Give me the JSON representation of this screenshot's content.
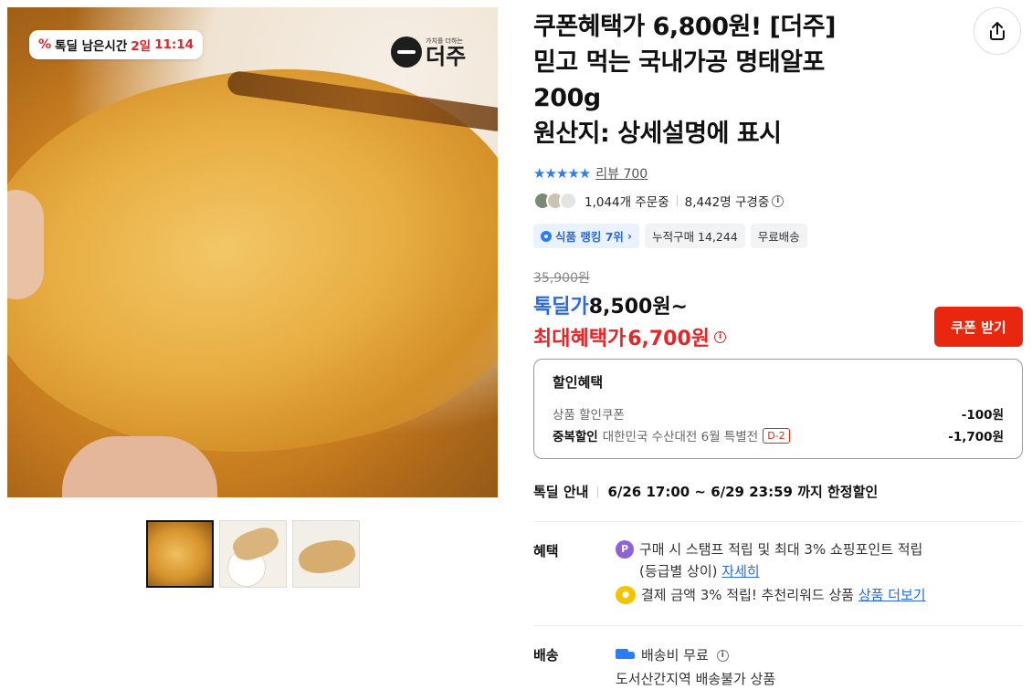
{
  "image": {
    "deal_timer": {
      "prefix": "톡딜 남은시간",
      "days": "2일",
      "time": "11:14"
    },
    "brand": {
      "sub": "가치를 더하는",
      "name": "더주"
    },
    "thumbnails": [
      "thumbnail-1",
      "thumbnail-2",
      "thumbnail-3"
    ]
  },
  "product": {
    "title_lines": [
      "쿠폰혜택가 6,800원! [더주]",
      "믿고 먹는 국내가공 명태알포",
      "200g",
      "원산지: 상세설명에 표시"
    ],
    "rating": {
      "stars": "★★★★★",
      "review_label": "리뷰 700"
    },
    "buyers": {
      "ordering": "1,044개 주문중",
      "browsing": "8,442명 구경중"
    },
    "chips": {
      "ranking": "식품 랭킹 7위",
      "cumulative": "누적구매 14,244",
      "free_shipping": "무료배송"
    },
    "price": {
      "original": "35,900원",
      "deal_label": "톡딜가",
      "deal_value": "8,500원~",
      "max_label": "최대혜택가",
      "max_value": "6,700원"
    },
    "coupon_button": "쿠폰 받기",
    "discount": {
      "heading": "할인혜택",
      "rows": [
        {
          "label": "상품 할인쿠폰",
          "value": "-100원"
        },
        {
          "bold": "중복할인",
          "label": "대한민국 수산대전 6월 특별전",
          "badge": "D-2",
          "value": "-1,700원"
        }
      ]
    },
    "deal_guide": {
      "label": "톡딜 안내",
      "value": "6/26 17:00 ~ 6/29 23:59 까지 한정할인"
    },
    "benefit": {
      "label": "혜택",
      "line1_a": "구매 시 스탬프 적립 및 최대 3% 쇼핑포인트 적립",
      "line1_b": "(등급별 상이)",
      "line1_link": "자세히",
      "line2": "결제 금액 3% 적립! 추천리워드 상품",
      "line2_link": "상품 더보기"
    },
    "shipping": {
      "label": "배송",
      "fee": "배송비 무료",
      "note": "도서산간지역 배송불가 상품"
    }
  },
  "colors": {
    "accent_blue": "#2c6ad8",
    "accent_red": "#e52528",
    "coupon_red": "#e8270e"
  }
}
